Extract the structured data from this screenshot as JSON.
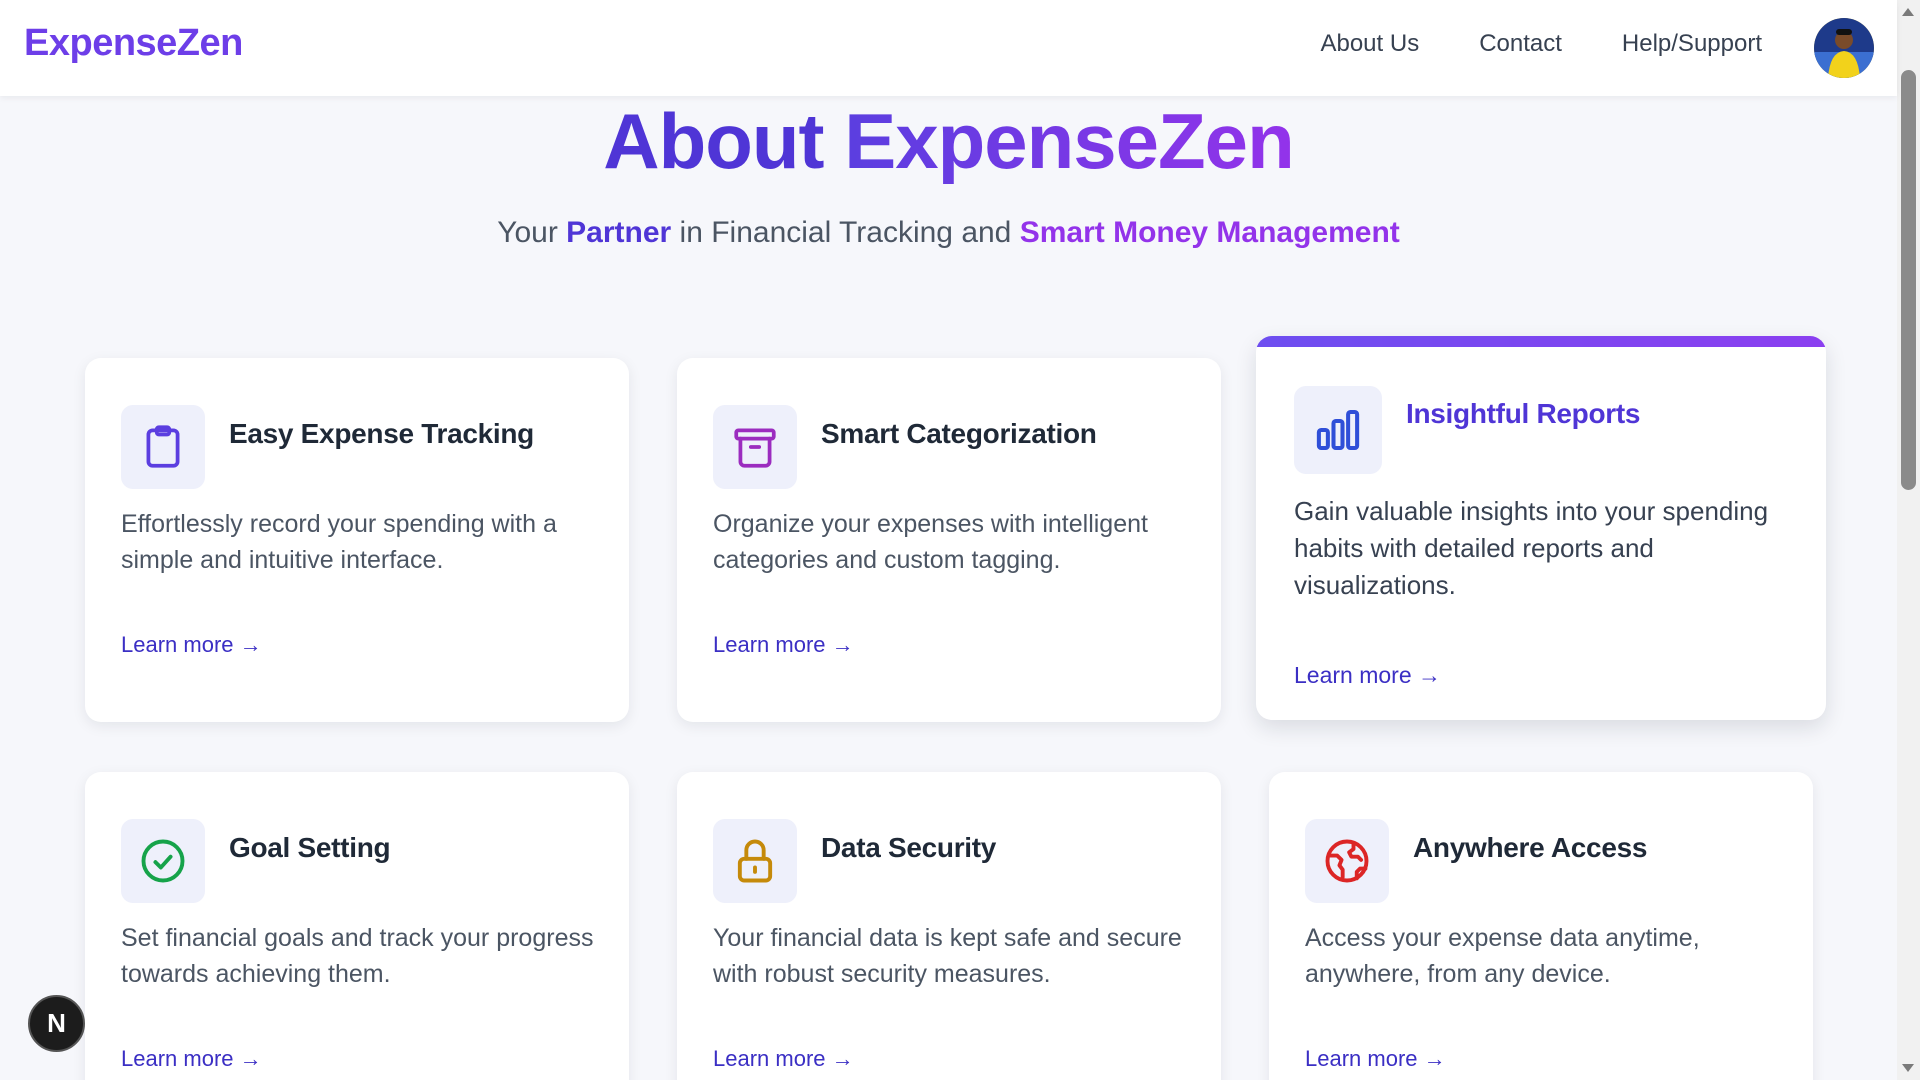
{
  "header": {
    "logo": "ExpenseZen",
    "nav": [
      {
        "label": "About Us"
      },
      {
        "label": "Contact"
      },
      {
        "label": "Help/Support"
      }
    ]
  },
  "hero": {
    "title_part1": "About",
    "title_part2": "ExpenseZen",
    "subtitle": {
      "s1": "Your ",
      "s2": "Partner",
      "s3": " in Financial Tracking and ",
      "s4": "Smart Money Management"
    }
  },
  "cards": [
    {
      "title": "Easy Expense Tracking",
      "desc": "Effortlessly record your spending with a simple and intuitive interface.",
      "link": "Learn more →",
      "icon": "clipboard-icon",
      "color": "#5b3ee0"
    },
    {
      "title": "Smart Categorization",
      "desc": "Organize your expenses with intelligent categories and custom tagging.",
      "link": "Learn more →",
      "icon": "archive-icon",
      "color": "#9b2cbf"
    },
    {
      "title": "Insightful Reports",
      "desc": "Gain valuable insights into your spending habits with detailed reports and visualizations.",
      "link": "Learn more →",
      "icon": "bar-chart-icon",
      "color": "#2f4fd8"
    },
    {
      "title": "Goal Setting",
      "desc": "Set financial goals and track your progress towards achieving them.",
      "link": "Learn more →",
      "icon": "check-circle-icon",
      "color": "#16a34a"
    },
    {
      "title": "Data Security",
      "desc": "Your financial data is kept safe and secure with robust security measures.",
      "link": "Learn more →",
      "icon": "lock-icon",
      "color": "#c58a0a"
    },
    {
      "title": "Anywhere Access",
      "desc": "Access your expense data anytime, anywhere, from any device.",
      "link": "Learn more →",
      "icon": "globe-icon",
      "color": "#dc2626"
    }
  ],
  "badge": {
    "label": "N"
  }
}
